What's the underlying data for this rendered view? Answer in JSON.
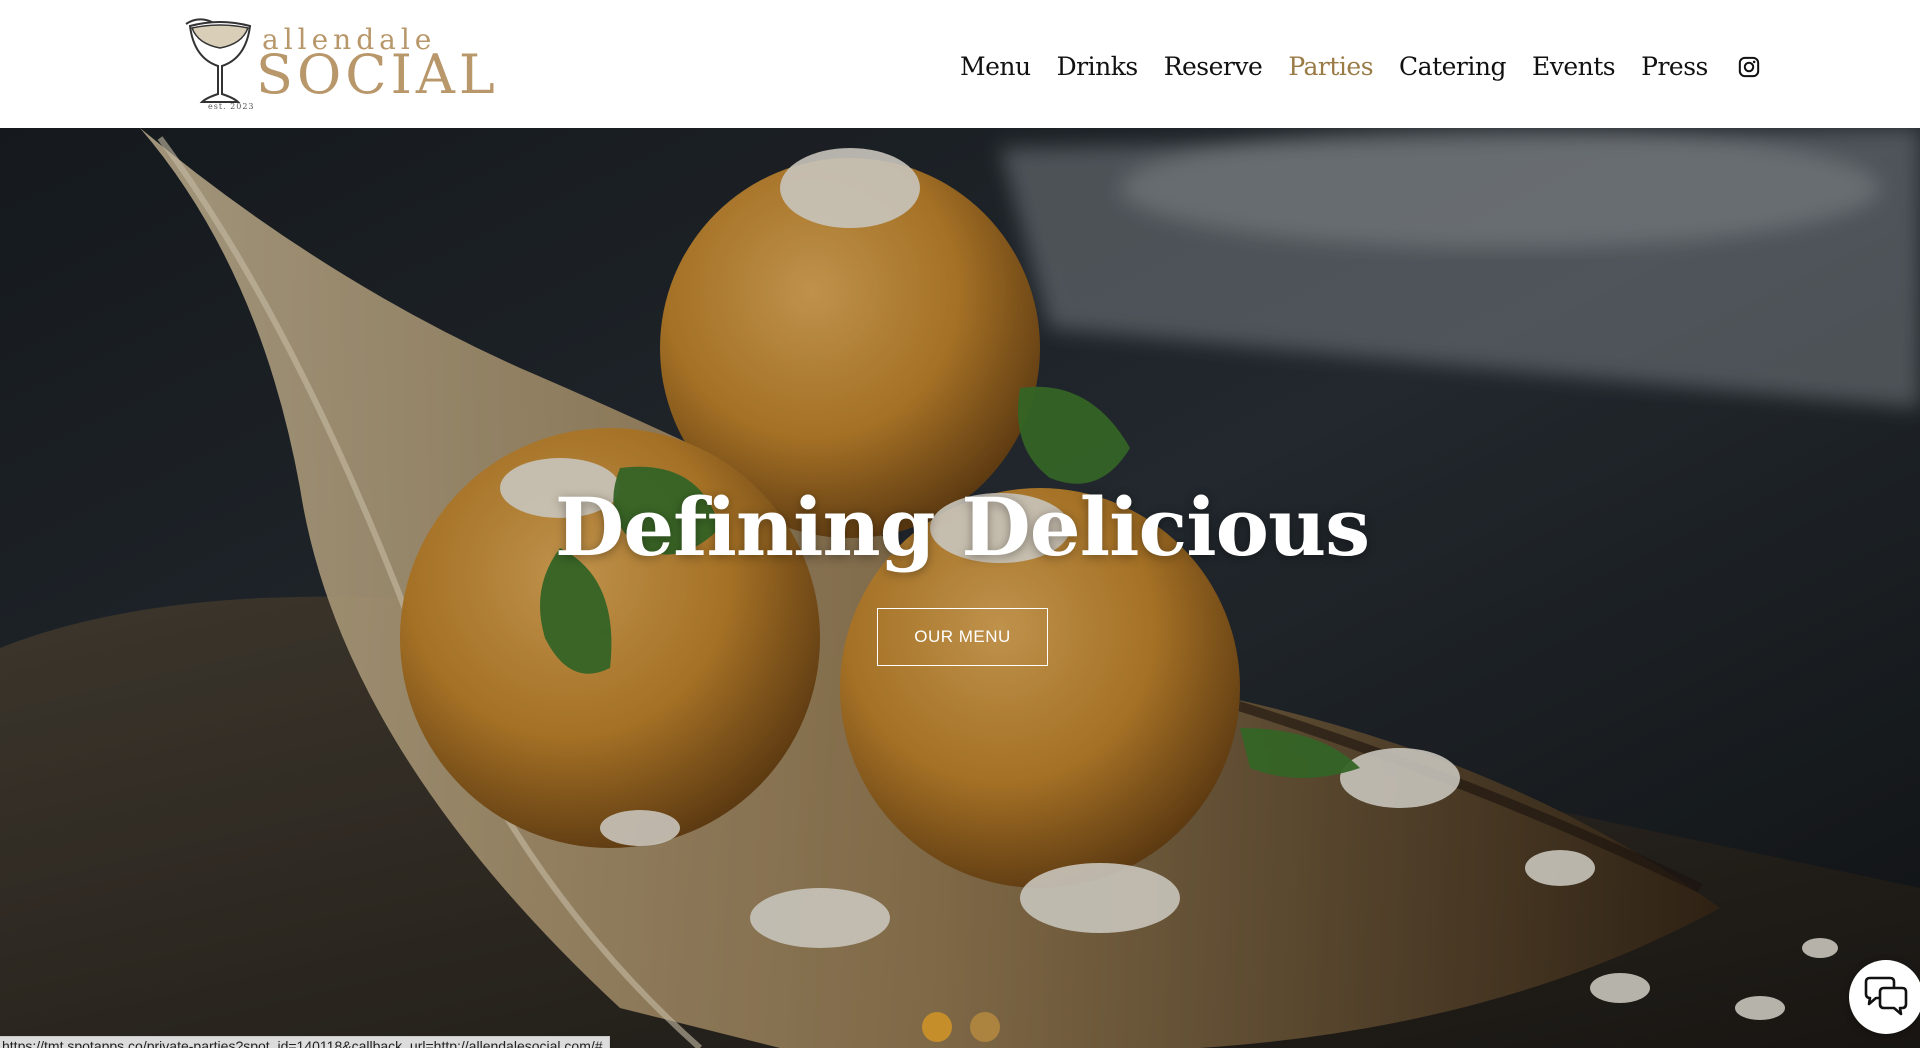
{
  "logo": {
    "small_text": "allendale",
    "big_text": "SOCIAL",
    "est_text": "est. 2023"
  },
  "nav": {
    "items": [
      {
        "label": "Menu",
        "active": false
      },
      {
        "label": "Drinks",
        "active": false
      },
      {
        "label": "Reserve",
        "active": false
      },
      {
        "label": "Parties",
        "active": true
      },
      {
        "label": "Catering",
        "active": false
      },
      {
        "label": "Events",
        "active": false
      },
      {
        "label": "Press",
        "active": false
      }
    ],
    "social_icon": "instagram-icon"
  },
  "hero": {
    "title": "Defining Delicious",
    "button_label": "OUR MENU",
    "slides_count": 2,
    "active_slide": 1
  },
  "status_bar": {
    "url": "https://tmt.spotapps.co/private-parties?spot_id=140118&callback_url=http://allendalesocial.com/#"
  },
  "chat": {
    "icon": "chat-bubbles-icon"
  },
  "colors": {
    "brand_gold": "#b8976a",
    "active_nav": "#9a7a45",
    "dot_color": "#c58e2a"
  }
}
